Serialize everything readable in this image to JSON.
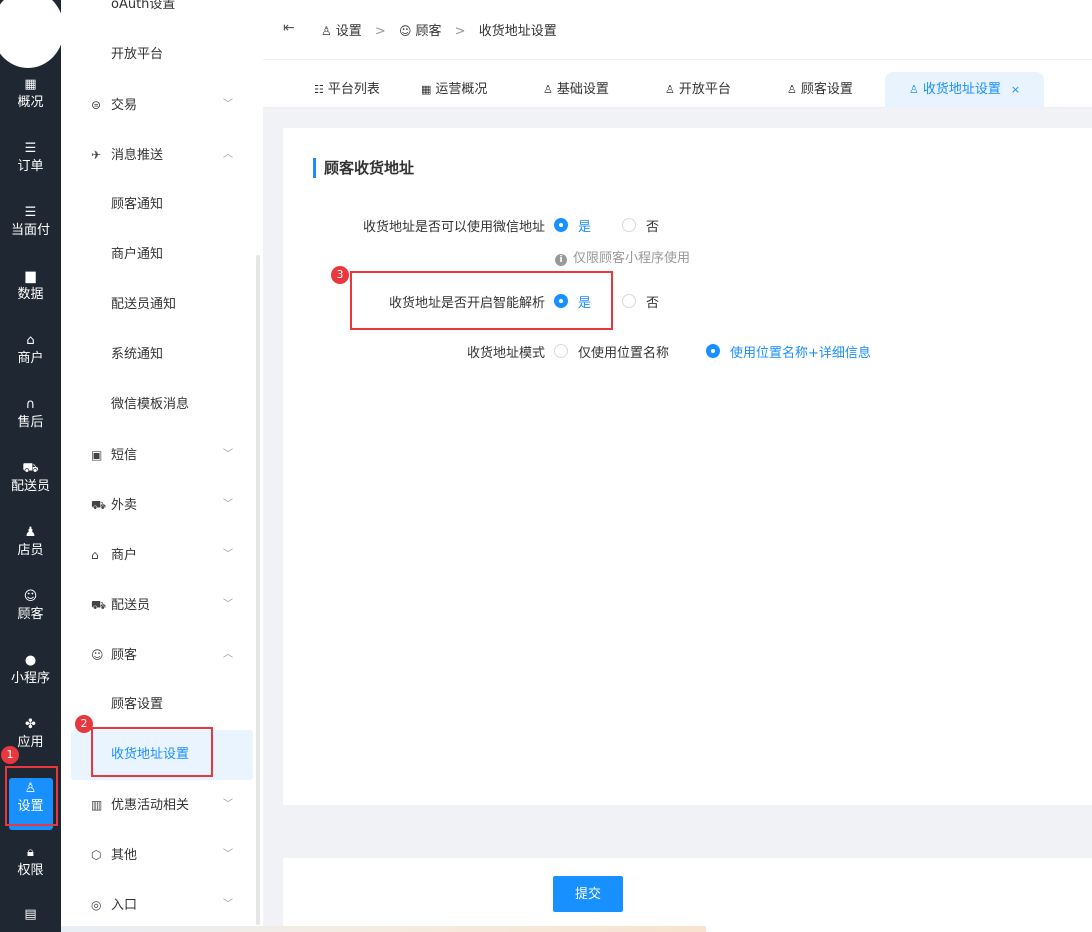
{
  "rail": {
    "items": [
      {
        "label": "概况",
        "icon": "overview-icon",
        "glyph": "▦"
      },
      {
        "label": "订单",
        "icon": "order-list-icon",
        "glyph": "☰"
      },
      {
        "label": "当面付",
        "icon": "pay-icon",
        "glyph": "☰"
      },
      {
        "label": "数据",
        "icon": "bar-chart-icon",
        "glyph": "▆"
      },
      {
        "label": "商户",
        "icon": "store-icon",
        "glyph": "⌂"
      },
      {
        "label": "售后",
        "icon": "headset-icon",
        "glyph": "∩"
      },
      {
        "label": "配送员",
        "icon": "delivery-icon",
        "glyph": "⛟"
      },
      {
        "label": "店员",
        "icon": "staff-icon",
        "glyph": "♟"
      },
      {
        "label": "顾客",
        "icon": "customer-icon",
        "glyph": "☺"
      },
      {
        "label": "小程序",
        "icon": "wechat-icon",
        "glyph": "●"
      },
      {
        "label": "应用",
        "icon": "apps-icon",
        "glyph": "✤"
      },
      {
        "label": "设置",
        "icon": "settings-user-icon",
        "glyph": "♙"
      },
      {
        "label": "权限",
        "icon": "lock-icon",
        "glyph": "🔒︎"
      }
    ],
    "bottom_icon": "report-icon",
    "bottom_glyph": "▤",
    "badge1": "1"
  },
  "submenu": {
    "items": [
      {
        "label": "oAuth设置",
        "type": "child"
      },
      {
        "label": "开放平台",
        "type": "child"
      },
      {
        "label": "交易",
        "type": "group",
        "icon": "trade-icon",
        "glyph": "⊜",
        "chevron": "﹀"
      },
      {
        "label": "消息推送",
        "type": "group",
        "icon": "message-icon",
        "glyph": "✈",
        "chevron": "︿"
      },
      {
        "label": "顾客通知",
        "type": "child"
      },
      {
        "label": "商户通知",
        "type": "child"
      },
      {
        "label": "配送员通知",
        "type": "child"
      },
      {
        "label": "系统通知",
        "type": "child"
      },
      {
        "label": "微信模板消息",
        "type": "child"
      },
      {
        "label": "短信",
        "type": "group",
        "icon": "sms-icon",
        "glyph": "▣",
        "chevron": "﹀"
      },
      {
        "label": "外卖",
        "type": "group",
        "icon": "takeout-icon",
        "glyph": "⛟",
        "chevron": "﹀"
      },
      {
        "label": "商户",
        "type": "group",
        "icon": "store-icon",
        "glyph": "⌂",
        "chevron": "﹀"
      },
      {
        "label": "配送员",
        "type": "group",
        "icon": "rider-icon",
        "glyph": "⛟",
        "chevron": "﹀"
      },
      {
        "label": "顾客",
        "type": "group",
        "icon": "customer-icon",
        "glyph": "☺",
        "chevron": "︿"
      },
      {
        "label": "顾客设置",
        "type": "child"
      },
      {
        "label": "收货地址设置",
        "type": "child",
        "selected": true
      },
      {
        "label": "优惠活动相关",
        "type": "group",
        "icon": "gift-icon",
        "glyph": "▥",
        "chevron": "﹀"
      },
      {
        "label": "其他",
        "type": "group",
        "icon": "hexagon-icon",
        "glyph": "⬡",
        "chevron": "﹀"
      },
      {
        "label": "入口",
        "type": "group",
        "icon": "compass-icon",
        "glyph": "◎",
        "chevron": "﹀"
      }
    ],
    "badge2": "2"
  },
  "header": {
    "collapse_glyph": "⇤",
    "breadcrumb": [
      "设置",
      "顾客",
      "收货地址设置"
    ],
    "sep": ">"
  },
  "tabs": [
    {
      "label": "平台列表",
      "icon": "list-icon",
      "glyph": "☷"
    },
    {
      "label": "运营概况",
      "icon": "dashboard-icon",
      "glyph": "▦"
    },
    {
      "label": "基础设置",
      "icon": "user-setting-icon",
      "glyph": "♙"
    },
    {
      "label": "开放平台",
      "icon": "user-setting-icon",
      "glyph": "♙"
    },
    {
      "label": "顾客设置",
      "icon": "user-setting-icon",
      "glyph": "♙"
    },
    {
      "label": "收货地址设置",
      "icon": "user-setting-icon",
      "glyph": "♙",
      "active": true,
      "close": "×"
    }
  ],
  "form": {
    "title": "顾客收货地址",
    "wechat_label": "收货地址是否可以使用微信地址",
    "wechat_yes": "是",
    "wechat_no": "否",
    "wechat_value": "是",
    "wechat_hint": "仅限顾客小程序使用",
    "hint_glyph": "i",
    "smart_label": "收货地址是否开启智能解析",
    "smart_yes": "是",
    "smart_no": "否",
    "smart_value": "是",
    "badge3": "3",
    "mode_label": "收货地址模式",
    "mode_opt1": "仅使用位置名称",
    "mode_opt2": "使用位置名称+详细信息",
    "mode_value": "使用位置名称+详细信息"
  },
  "footer": {
    "submit_label": "提交"
  },
  "colors": {
    "accent": "#1890ff",
    "rail_bg": "#1f2733",
    "highlight_red": "#e8383d"
  }
}
